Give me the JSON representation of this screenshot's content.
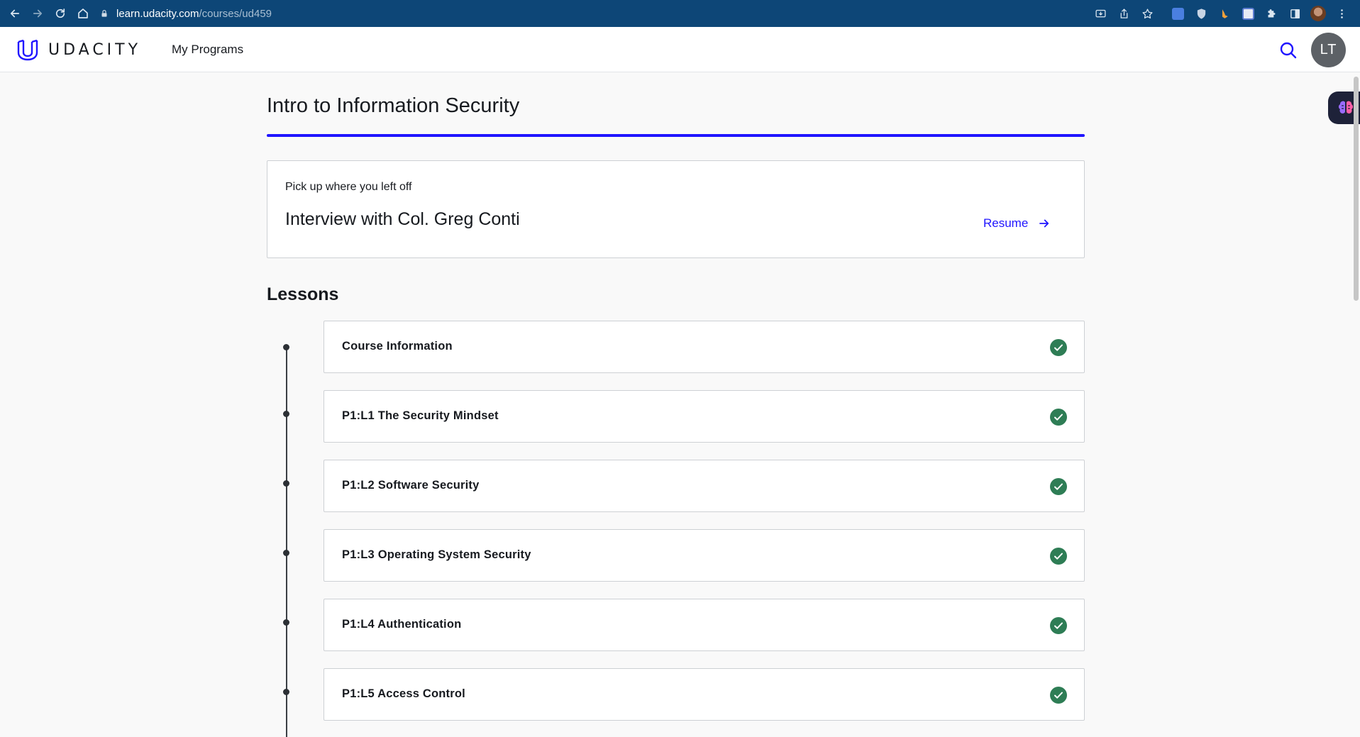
{
  "browser": {
    "url_host": "learn.udacity.com",
    "url_path": "/courses/ud459"
  },
  "header": {
    "logo_text": "UDACITY",
    "nav_link": "My Programs",
    "avatar_initials": "LT"
  },
  "course": {
    "title": "Intro to Information Security"
  },
  "resume_card": {
    "label": "Pick up where you left off",
    "lesson_title": "Interview with Col. Greg Conti",
    "resume_label": "Resume"
  },
  "lessons": {
    "heading": "Lessons",
    "items": [
      {
        "title": "Course Information",
        "status": "completed"
      },
      {
        "title": "P1:L1 The Security Mindset",
        "status": "completed"
      },
      {
        "title": "P1:L2 Software Security",
        "status": "completed"
      },
      {
        "title": "P1:L3 Operating System Security",
        "status": "completed"
      },
      {
        "title": "P1:L4 Authentication",
        "status": "completed"
      },
      {
        "title": "P1:L5 Access Control",
        "status": "completed"
      }
    ]
  },
  "colors": {
    "accent": "#2015ff",
    "complete": "#2e7d55",
    "browser_bar": "#0d4677"
  }
}
